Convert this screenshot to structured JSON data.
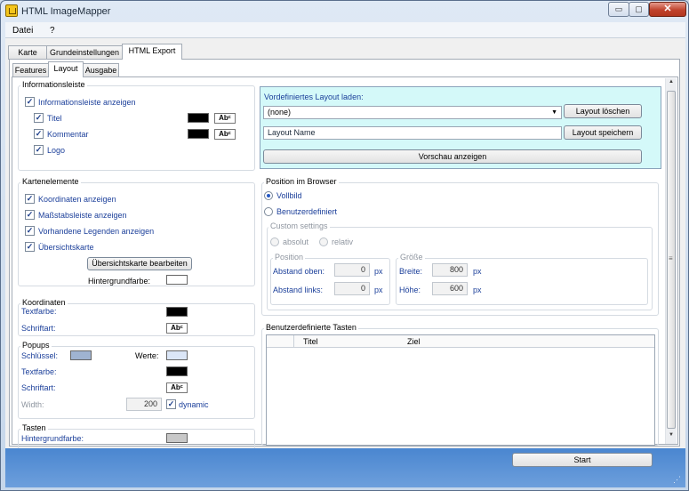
{
  "window": {
    "title": "HTML ImageMapper",
    "min_glyph": "▭",
    "max_glyph": "▢",
    "close_glyph": "✕"
  },
  "menu": [
    "Datei",
    "?"
  ],
  "main_tabs": [
    "Karte",
    "Grundeinstellungen",
    "HTML Export"
  ],
  "sub_tabs": [
    "Features",
    "Layout",
    "Ausgabe"
  ],
  "icons": {
    "checkmark": "✓",
    "dropdown": "▼",
    "scroll_up": "▲",
    "scroll_down": "▼",
    "scroll_grip": "≡",
    "resize_grip": "⋰"
  },
  "colors": {
    "black": "#000000",
    "white": "#ffffff",
    "key_blue": "#9fb3d1",
    "value_blue": "#dbe6f7",
    "gray": "#c8c8c8",
    "preset_bg": "#d4f9f9"
  },
  "informationsleiste": {
    "title": "Informationsleiste",
    "show_label": "Informationsleiste anzeigen",
    "titel_label": "Titel",
    "kommentar_label": "Kommentar",
    "logo_label": "Logo",
    "font_button": "Abᶜ"
  },
  "kartenelemente": {
    "title": "Kartenelemente",
    "items": [
      "Koordinaten anzeigen",
      "Maßstabsleiste anzeigen",
      "Vorhandene Legenden anzeigen",
      "Übersichtskarte"
    ],
    "edit_button": "Übersichtskarte bearbeiten",
    "bg_label": "Hintergrundfarbe:"
  },
  "koordinaten": {
    "title": "Koordinaten",
    "textcolor_label": "Textfarbe:",
    "font_label": "Schriftart:"
  },
  "popups": {
    "title": "Popups",
    "key_label": "Schlüssel:",
    "values_label": "Werte:",
    "textcolor_label": "Textfarbe:",
    "font_label": "Schriftart:",
    "width_label": "Width:",
    "width_value": "200",
    "dynamic_label": "dynamic"
  },
  "tasten": {
    "title": "Tasten",
    "bg_label": "Hintergrundfarbe:"
  },
  "preset": {
    "label": "Vordefiniertes Layout laden:",
    "selected": "(none)",
    "delete_button": "Layout löschen",
    "name_placeholder": "Layout Name",
    "save_button": "Layout speichern",
    "preview_button": "Vorschau anzeigen"
  },
  "position": {
    "title": "Position im Browser",
    "option_full": "Vollbild",
    "option_custom": "Benutzerdefiniert",
    "custom_title": "Custom settings",
    "absolute_label": "absolut",
    "relative_label": "relativ",
    "pos_title": "Position",
    "top_label": "Abstand oben:",
    "top_value": "0",
    "left_label": "Abstand links:",
    "left_value": "0",
    "unit": "px",
    "size_title": "Größe",
    "width_label": "Breite:",
    "width_value": "800",
    "height_label": "Höhe:",
    "height_value": "600"
  },
  "buttons_table": {
    "title": "Benutzerdefinierte Tasten",
    "columns": [
      "Titel",
      "Ziel"
    ]
  },
  "footer": {
    "start_button": "Start"
  }
}
